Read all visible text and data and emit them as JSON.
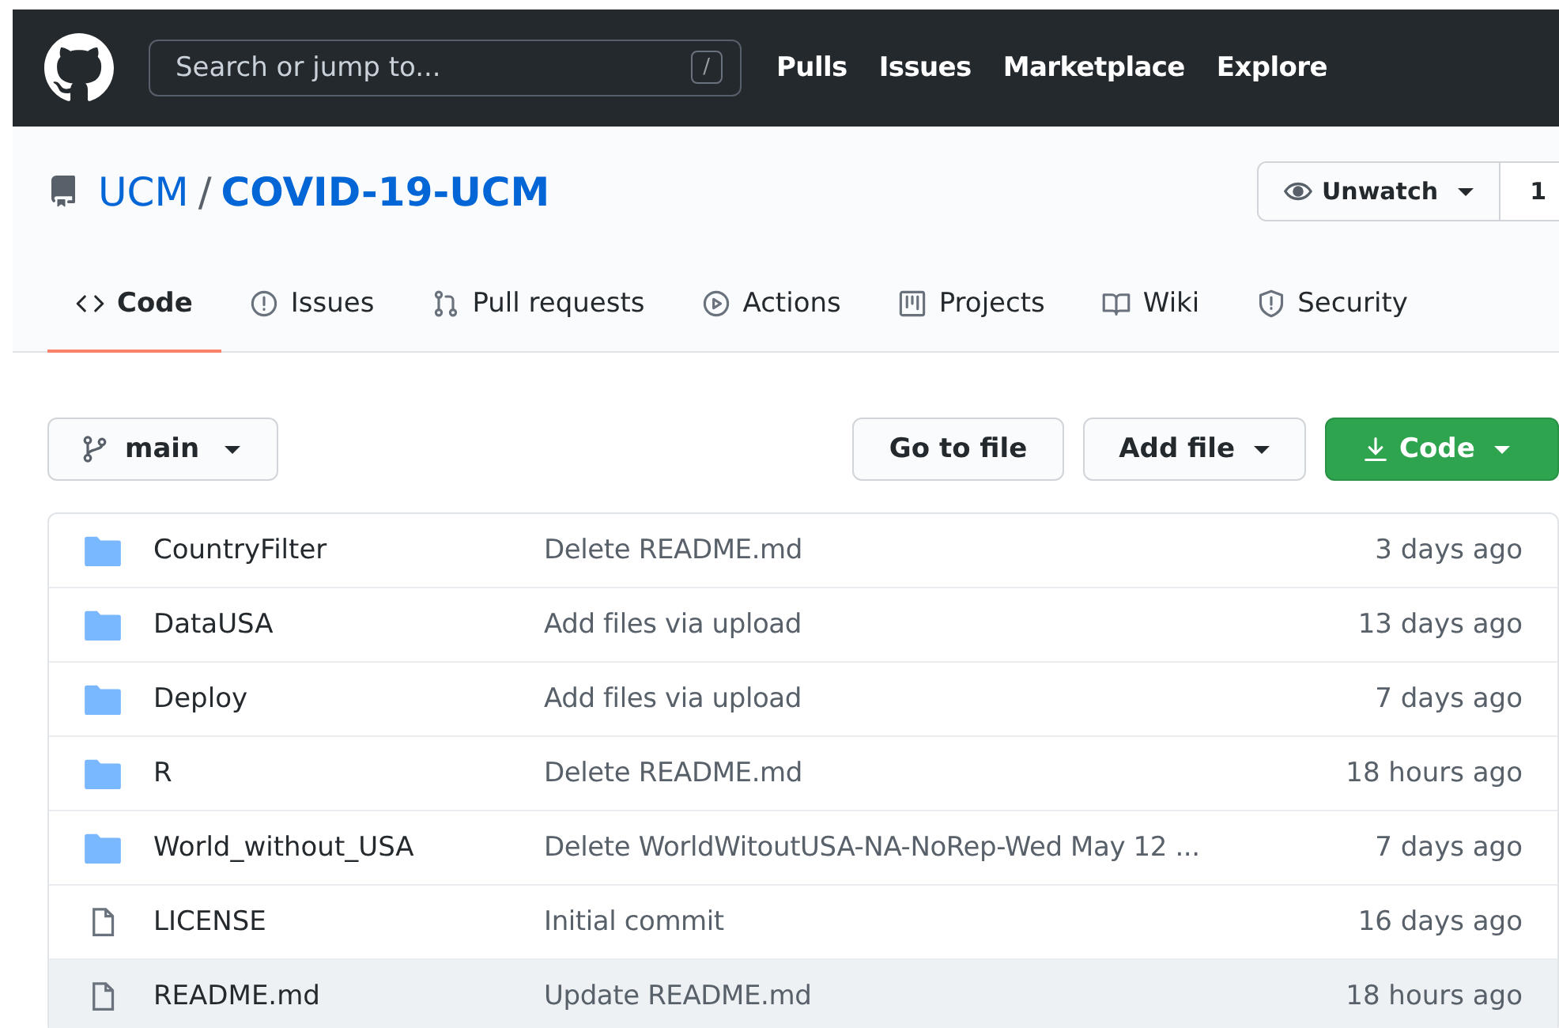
{
  "header": {
    "search": {
      "placeholder": "Search or jump to...",
      "shortcut": "/"
    },
    "nav": [
      "Pulls",
      "Issues",
      "Marketplace",
      "Explore"
    ]
  },
  "repo": {
    "owner": "UCM",
    "separator": "/",
    "name": "COVID-19-UCM",
    "watch": {
      "label": "Unwatch",
      "count": "1"
    }
  },
  "tabs": [
    {
      "label": "Code",
      "selected": true
    },
    {
      "label": "Issues",
      "selected": false
    },
    {
      "label": "Pull requests",
      "selected": false
    },
    {
      "label": "Actions",
      "selected": false
    },
    {
      "label": "Projects",
      "selected": false
    },
    {
      "label": "Wiki",
      "selected": false
    },
    {
      "label": "Security",
      "selected": false
    }
  ],
  "toolbar": {
    "branch": "main",
    "go_to_file": "Go to file",
    "add_file": "Add file",
    "code": "Code"
  },
  "files": [
    {
      "kind": "folder",
      "name": "CountryFilter",
      "message": "Delete README.md",
      "age": "3 days ago",
      "selected": false
    },
    {
      "kind": "folder",
      "name": "DataUSA",
      "message": "Add files via upload",
      "age": "13 days ago",
      "selected": false
    },
    {
      "kind": "folder",
      "name": "Deploy",
      "message": "Add files via upload",
      "age": "7 days ago",
      "selected": false
    },
    {
      "kind": "folder",
      "name": "R",
      "message": "Delete README.md",
      "age": "18 hours ago",
      "selected": false
    },
    {
      "kind": "folder",
      "name": "World_without_USA",
      "message": "Delete WorldWitoutUSA-NA-NoRep-Wed May 12 ...",
      "age": "7 days ago",
      "selected": false
    },
    {
      "kind": "file",
      "name": "LICENSE",
      "message": "Initial commit",
      "age": "16 days ago",
      "selected": false
    },
    {
      "kind": "file",
      "name": "README.md",
      "message": "Update README.md",
      "age": "18 hours ago",
      "selected": true
    }
  ]
}
